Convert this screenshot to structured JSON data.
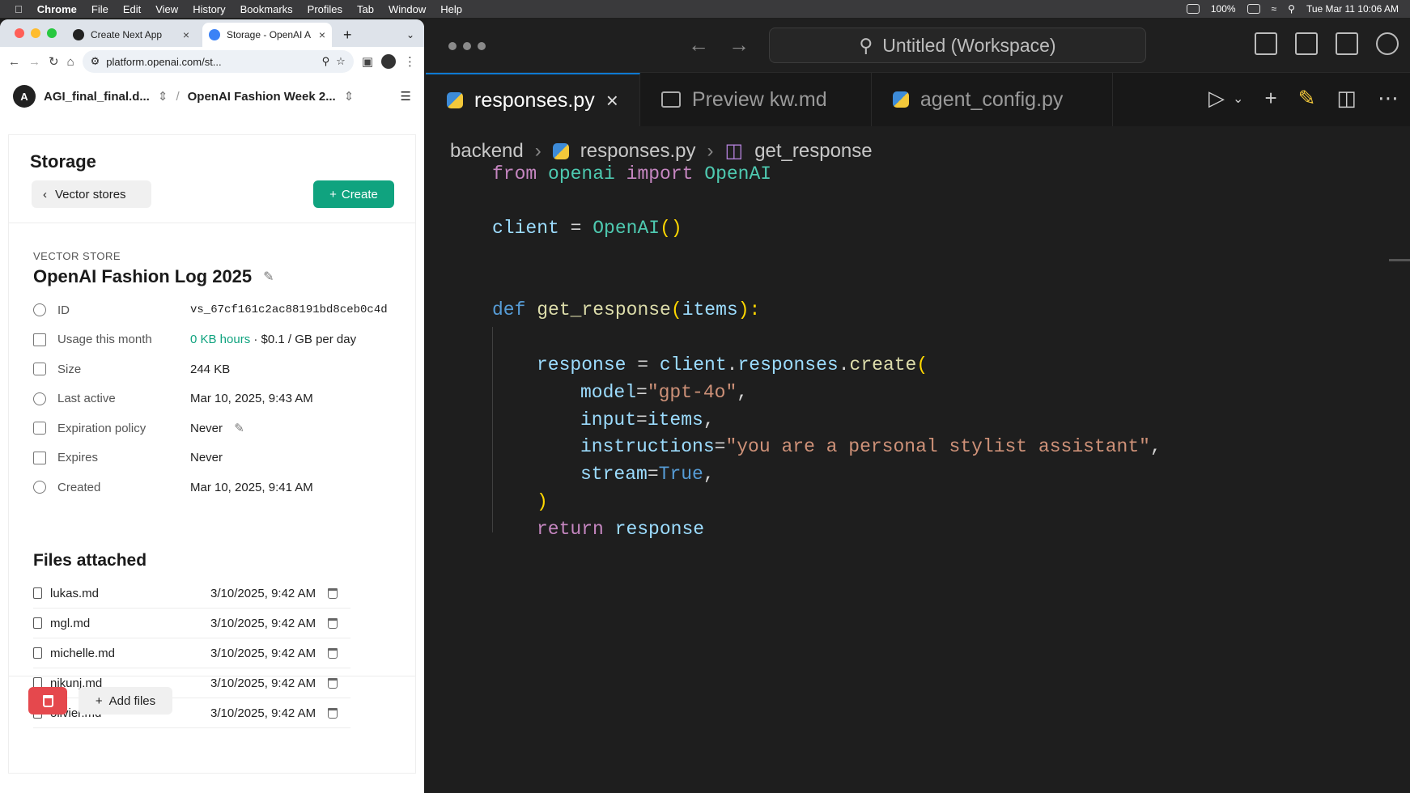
{
  "menubar": {
    "app": "Chrome",
    "items": [
      "File",
      "Edit",
      "View",
      "History",
      "Bookmarks",
      "Profiles",
      "Tab",
      "Window",
      "Help"
    ],
    "battery": "100%",
    "datetime": "Tue Mar 11  10:06 AM"
  },
  "chrome": {
    "tabs": [
      {
        "label": "Create Next App"
      },
      {
        "label": "Storage - OpenAI A"
      }
    ],
    "url": "platform.openai.com/st...",
    "project": {
      "avatar": "A",
      "org": "AGI_final_final.d...",
      "separator": "/",
      "project": "OpenAI Fashion Week 2..."
    }
  },
  "storage": {
    "heading": "Storage",
    "back_label": "Vector stores",
    "create_label": "Create",
    "vector_store_label": "VECTOR STORE",
    "title": "OpenAI Fashion Log 2025",
    "props": [
      {
        "key": "ID",
        "value": "vs_67cf161c2ac88191bd8ceb0c4d"
      },
      {
        "key": "Usage this month",
        "value_link": "0 KB hours",
        "value": " · $0.1 / GB per day"
      },
      {
        "key": "Size",
        "value": "244 KB"
      },
      {
        "key": "Last active",
        "value": "Mar 10, 2025, 9:43 AM"
      },
      {
        "key": "Expiration policy",
        "value": "Never"
      },
      {
        "key": "Expires",
        "value": "Never"
      },
      {
        "key": "Created",
        "value": "Mar 10, 2025, 9:41 AM"
      }
    ],
    "files_heading": "Files attached",
    "files": [
      {
        "name": "lukas.md",
        "date": "3/10/2025, 9:42 AM"
      },
      {
        "name": "mgl.md",
        "date": "3/10/2025, 9:42 AM"
      },
      {
        "name": "michelle.md",
        "date": "3/10/2025, 9:42 AM"
      },
      {
        "name": "nikunj.md",
        "date": "3/10/2025, 9:42 AM"
      },
      {
        "name": "olivier.md",
        "date": "3/10/2025, 9:42 AM"
      }
    ],
    "add_files_label": "Add files"
  },
  "vscode": {
    "search": "Untitled (Workspace)",
    "tabs": [
      {
        "label": "responses.py"
      },
      {
        "label": "Preview kw.md"
      },
      {
        "label": "agent_config.py"
      }
    ],
    "breadcrumb": [
      "backend",
      "responses.py",
      "get_response"
    ],
    "code": {
      "l1": [
        "from",
        " openai ",
        "import",
        " OpenAI"
      ],
      "l2": [
        "client",
        " = ",
        "OpenAI",
        "()"
      ],
      "l3": [
        "def",
        " ",
        "get_response",
        "(",
        "items",
        "):"
      ],
      "l4": [
        "response",
        " = ",
        "client",
        ".",
        "responses",
        ".",
        "create",
        "("
      ],
      "l5": [
        "model",
        "=",
        "\"gpt-4o\"",
        ","
      ],
      "l6": [
        "input",
        "=",
        "items",
        ","
      ],
      "l7": [
        "instructions",
        "=",
        "\"you are a personal stylist assistant\"",
        ","
      ],
      "l8": [
        "stream",
        "=",
        "True",
        ","
      ],
      "l9": [
        ")"
      ],
      "l10": [
        "return",
        " ",
        "response"
      ]
    }
  }
}
